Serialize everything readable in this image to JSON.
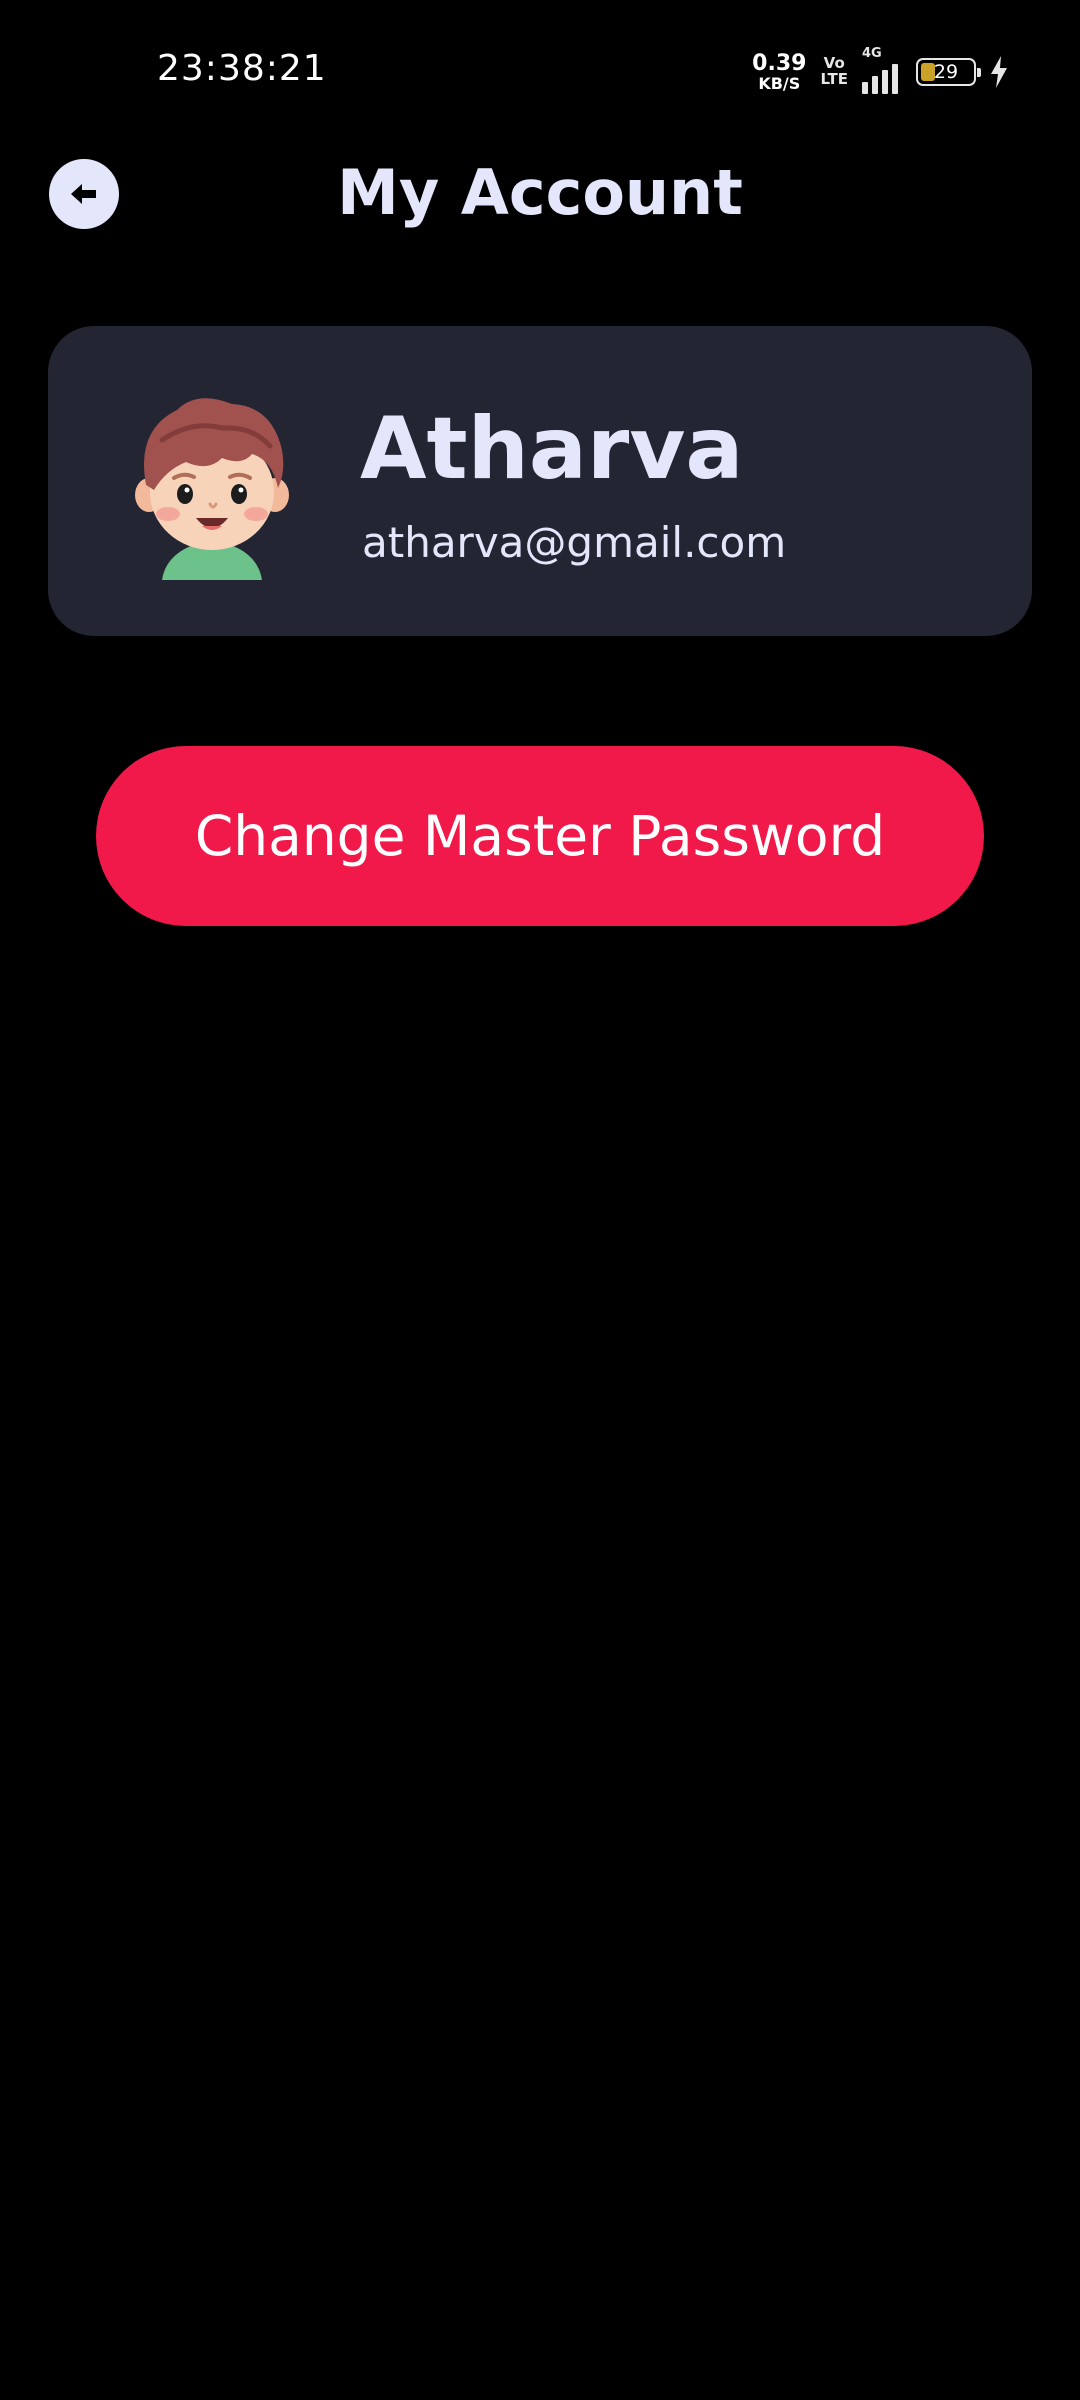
{
  "status_bar": {
    "time": "23:38:21",
    "net_speed_value": "0.39",
    "net_speed_unit": "KB/S",
    "volte_top": "Vo",
    "volte_bottom": "LTE",
    "network_type": "4G",
    "battery_level": "29"
  },
  "header": {
    "title": "My Account",
    "back_icon": "arrow-left-icon"
  },
  "profile": {
    "name": "Atharva",
    "email": "atharva@gmail.com",
    "avatar": "boy-cartoon-avatar"
  },
  "actions": {
    "change_password_label": "Change Master Password"
  },
  "colors": {
    "background": "#000000",
    "card": "#232533",
    "accent": "#f1194a",
    "title_text": "#e4e6fb",
    "back_button_bg": "#e4e6fb"
  }
}
